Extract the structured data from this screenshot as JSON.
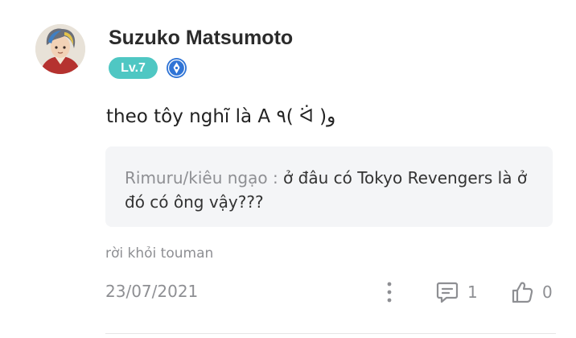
{
  "comment": {
    "username": "Suzuko Matsumoto",
    "level": "Lv.7",
    "text": "theo tôy nghĩ là A ٩( ᐛ )و",
    "quote": {
      "author": "Rimuru/kiêu ngạo :",
      "text": " ở đâu có Tokyo Revengers là ở đó có ông vậy???"
    },
    "group": "rời khỏi touman",
    "date": "23/07/2021",
    "reply_count": "1",
    "like_count": "0"
  },
  "colors": {
    "level_badge": "#4fc7c3",
    "pen_badge": "#2f74d6",
    "muted_text": "#8e8f93",
    "quote_bg": "#f4f5f7"
  },
  "icons": [
    "avatar",
    "pen-badge-icon",
    "more-icon",
    "reply-icon",
    "like-icon"
  ]
}
